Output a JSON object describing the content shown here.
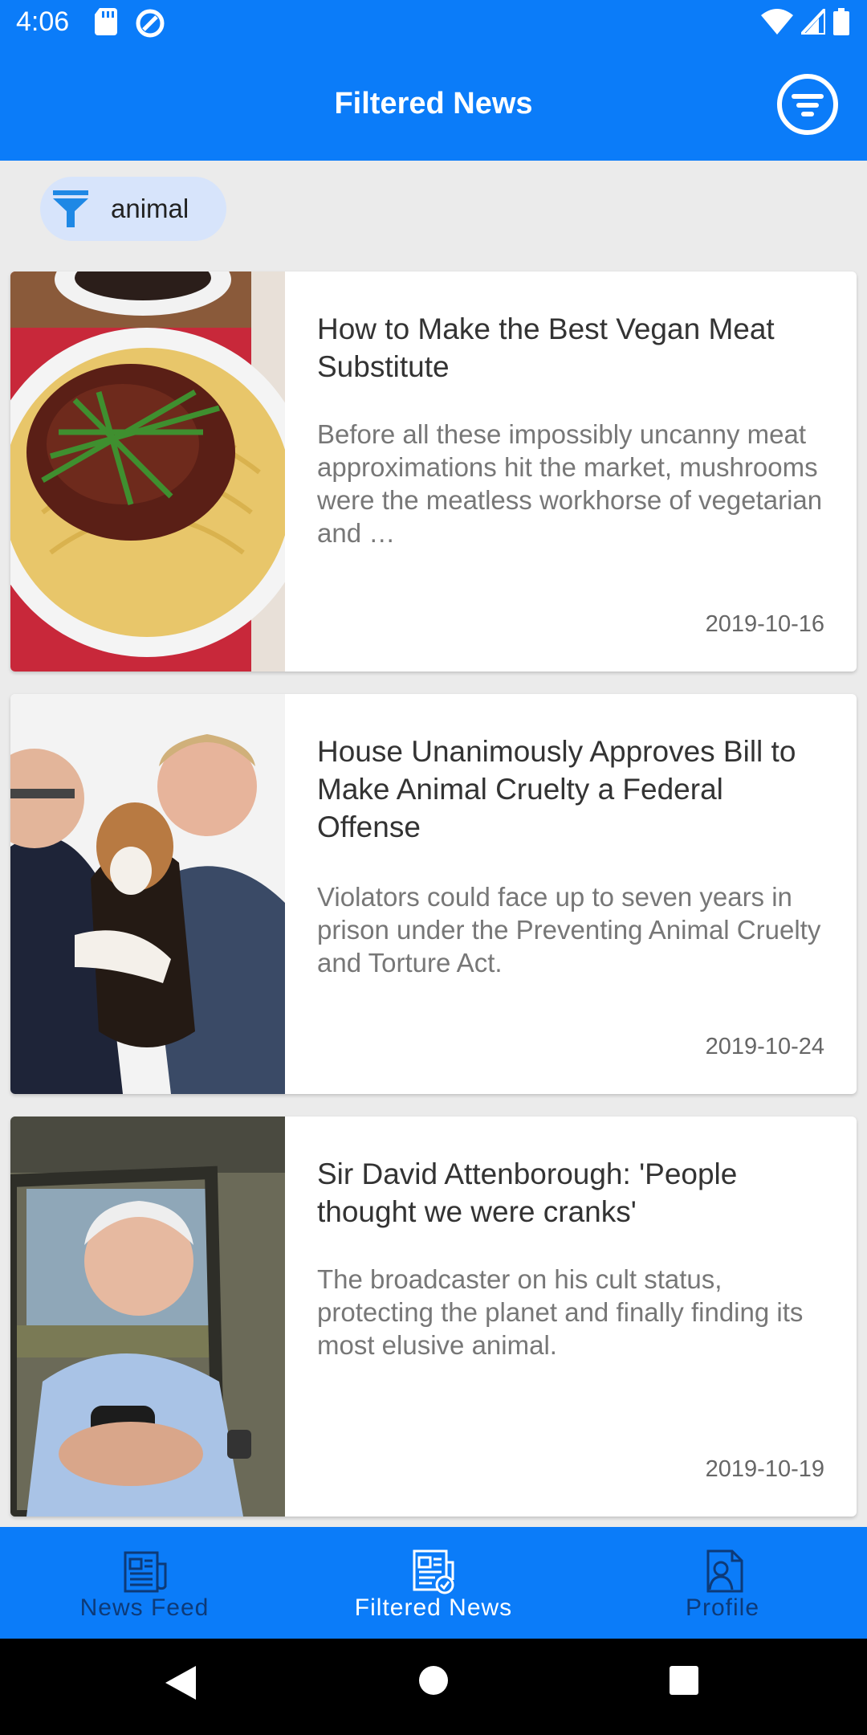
{
  "status_bar": {
    "time": "4:06"
  },
  "app_bar": {
    "title": "Filtered News"
  },
  "filter_chip": {
    "label": "animal"
  },
  "articles": [
    {
      "title": "How to Make the Best Vegan Meat Substitute",
      "description": "Before all these impossibly uncanny meat approximations hit the market, mushrooms were the meatless workhorse of vegetarian and …",
      "date": "2019-10-16"
    },
    {
      "title": "House Unanimously Approves Bill to Make Animal Cruelty a Federal Offense",
      "description": "Violators could face up to seven years in prison under the Preventing Animal Cruelty and Torture Act.",
      "date": "2019-10-24"
    },
    {
      "title": "Sir David Attenborough: 'People thought we were cranks'",
      "description": "The broadcaster on his cult status, protecting the planet and finally finding its most elusive animal.",
      "date": "2019-10-19"
    }
  ],
  "bottom_nav": {
    "items": [
      {
        "label": "News Feed",
        "icon": "newspaper-icon",
        "active": false
      },
      {
        "label": "Filtered News",
        "icon": "filtered-newspaper-icon",
        "active": true
      },
      {
        "label": "Profile",
        "icon": "profile-document-icon",
        "active": false
      }
    ]
  },
  "colors": {
    "primary": "#0b7cf9",
    "chip_background": "#d7e4fb",
    "nav_inactive_text": "#0d3a78",
    "background": "#ebebeb"
  }
}
